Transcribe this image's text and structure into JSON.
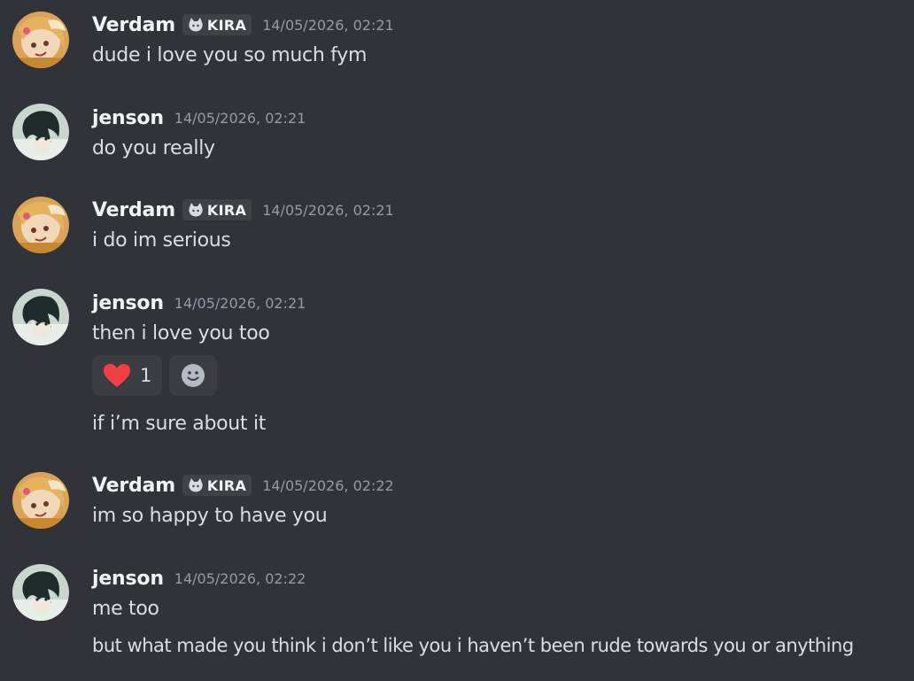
{
  "messages": [
    {
      "author": "Verdam",
      "tag": "KIRA",
      "timestamp": "14/05/2026, 02:21",
      "lines": [
        "dude i love you so much fym"
      ]
    },
    {
      "author": "jenson",
      "timestamp": "14/05/2026, 02:21",
      "lines": [
        "do you really"
      ]
    },
    {
      "author": "Verdam",
      "tag": "KIRA",
      "timestamp": "14/05/2026, 02:21",
      "lines": [
        "i do im serious"
      ]
    },
    {
      "author": "jenson",
      "timestamp": "14/05/2026, 02:21",
      "lines": [
        "then i love you too",
        "if i’m sure about it"
      ]
    },
    {
      "author": "Verdam",
      "tag": "KIRA",
      "timestamp": "14/05/2026, 02:22",
      "lines": [
        "im so happy to have you"
      ]
    },
    {
      "author": "jenson",
      "timestamp": "14/05/2026, 02:22",
      "lines": [
        "me too",
        "but what made you think i don’t like you i haven’t been rude towards you or anything"
      ]
    }
  ],
  "reactions": [
    {
      "emoji": "heart-icon",
      "count": "1"
    }
  ],
  "add_reaction_icon": "smiley-add-reaction-icon",
  "colors": {
    "background": "#313338",
    "username": "#f2f3f5",
    "timestamp": "#949ba4",
    "text": "#dbdee1",
    "reaction_bg": "#3b3d43",
    "heart": "#f23f43"
  }
}
